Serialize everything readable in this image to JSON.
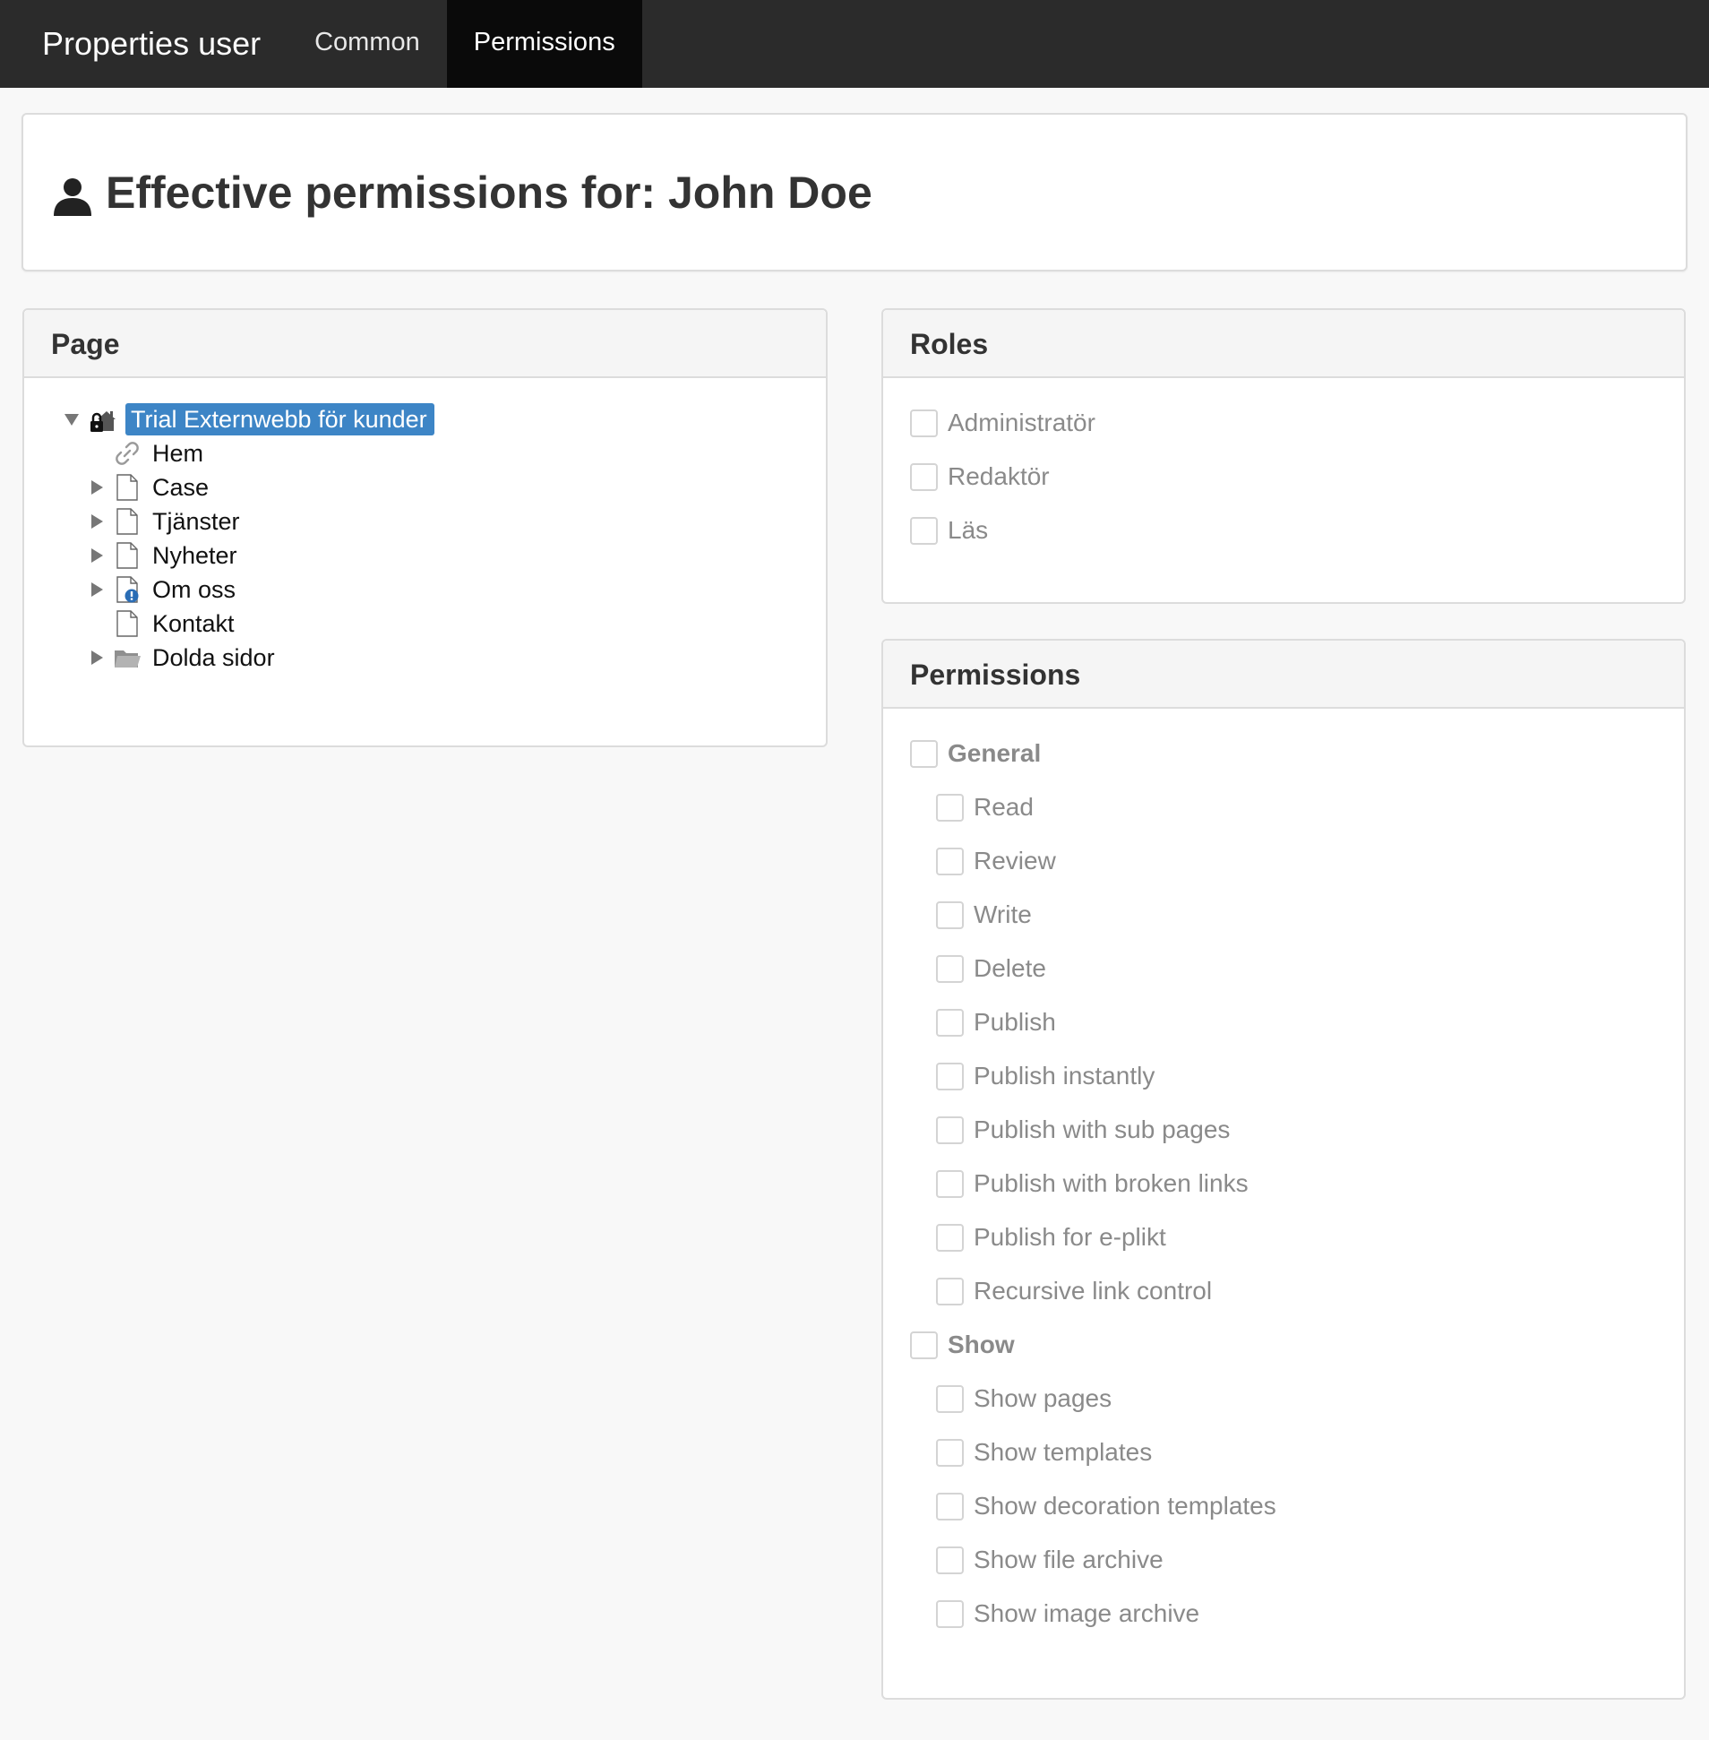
{
  "nav": {
    "title": "Properties user",
    "tabs": [
      {
        "label": "Common",
        "active": false
      },
      {
        "label": "Permissions",
        "active": true
      }
    ]
  },
  "header": {
    "icon": "user-icon",
    "prefix": "Effective permissions for: ",
    "user_name": "John Doe"
  },
  "page_panel": {
    "heading": "Page",
    "tree": [
      {
        "label": "Trial Externwebb för kunder",
        "icon": "locked-home-icon",
        "toggle": "expanded",
        "selected": true
      },
      {
        "label": "Hem",
        "icon": "link-icon",
        "toggle": "none",
        "selected": false
      },
      {
        "label": "Case",
        "icon": "page-icon",
        "toggle": "collapsed",
        "selected": false
      },
      {
        "label": "Tjänster",
        "icon": "page-icon",
        "toggle": "collapsed",
        "selected": false
      },
      {
        "label": "Nyheter",
        "icon": "page-icon",
        "toggle": "collapsed",
        "selected": false
      },
      {
        "label": "Om oss",
        "icon": "page-info-icon",
        "toggle": "collapsed",
        "selected": false
      },
      {
        "label": "Kontakt",
        "icon": "page-icon",
        "toggle": "none",
        "selected": false
      },
      {
        "label": "Dolda sidor",
        "icon": "folder-icon",
        "toggle": "collapsed",
        "selected": false
      }
    ]
  },
  "roles_panel": {
    "heading": "Roles",
    "items": [
      {
        "label": "Administratör",
        "checked": false
      },
      {
        "label": "Redaktör",
        "checked": false
      },
      {
        "label": "Läs",
        "checked": false
      }
    ]
  },
  "permissions_panel": {
    "heading": "Permissions",
    "items": [
      {
        "label": "General",
        "group": true,
        "checked": false
      },
      {
        "label": "Read",
        "group": false,
        "checked": false
      },
      {
        "label": "Review",
        "group": false,
        "checked": false
      },
      {
        "label": "Write",
        "group": false,
        "checked": false
      },
      {
        "label": "Delete",
        "group": false,
        "checked": false
      },
      {
        "label": "Publish",
        "group": false,
        "checked": false
      },
      {
        "label": "Publish instantly",
        "group": false,
        "checked": false
      },
      {
        "label": "Publish with sub pages",
        "group": false,
        "checked": false
      },
      {
        "label": "Publish with broken links",
        "group": false,
        "checked": false
      },
      {
        "label": "Publish for e-plikt",
        "group": false,
        "checked": false
      },
      {
        "label": "Recursive link control",
        "group": false,
        "checked": false
      },
      {
        "label": "Show",
        "group": true,
        "checked": false
      },
      {
        "label": "Show pages",
        "group": false,
        "checked": false
      },
      {
        "label": "Show templates",
        "group": false,
        "checked": false
      },
      {
        "label": "Show decoration templates",
        "group": false,
        "checked": false
      },
      {
        "label": "Show file archive",
        "group": false,
        "checked": false
      },
      {
        "label": "Show image archive",
        "group": false,
        "checked": false
      }
    ]
  },
  "colors": {
    "nav_bg": "#2b2b2b",
    "nav_active": "#0a0a0a",
    "selection": "#3d85c6",
    "disabled_text": "#8a8a8a"
  }
}
